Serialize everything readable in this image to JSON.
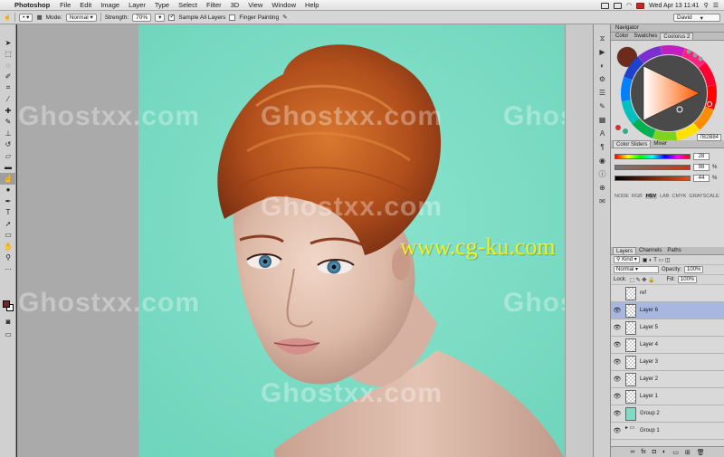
{
  "menubar": {
    "app_name": "Photoshop",
    "items": [
      "File",
      "Edit",
      "Image",
      "Layer",
      "Type",
      "Select",
      "Filter",
      "3D",
      "View",
      "Window",
      "Help"
    ],
    "clock": "Wed Apr 13  11:41"
  },
  "options_bar": {
    "mode_label": "Mode:",
    "mode_value": "Normal",
    "strength_label": "Strength:",
    "strength_value": "70%",
    "sample_all_layers": "Sample All Layers",
    "finger_painting": "Finger Painting",
    "workspace": "David"
  },
  "colours_panel": {
    "tabs": [
      "Color",
      "Swatches",
      "Coolorus 2"
    ],
    "hex": "7B2B84",
    "foreground_color": "#6e2a1b"
  },
  "navigator_tab": "Navigator",
  "sliders_panel": {
    "tabs": [
      "Color Sliders",
      "Mixer"
    ],
    "rows": [
      {
        "value": "28",
        "unit": "",
        "color": "#f00"
      },
      {
        "value": "98",
        "unit": "%",
        "color": "#6e2a1b"
      },
      {
        "value": "44",
        "unit": "%",
        "color": "#6e2a1b"
      }
    ],
    "modes": [
      "NODE",
      "RGB",
      "HSV",
      "LAB",
      "CMYK",
      "GRAYSCALE"
    ],
    "selected_mode": "HSV"
  },
  "layers_panel": {
    "tabs": [
      "Layers",
      "Channels",
      "Paths"
    ],
    "kind": "Kind",
    "blend_mode": "Normal",
    "opacity_label": "Opacity:",
    "opacity": "100%",
    "lock_label": "Lock:",
    "fill_label": "Fill:",
    "fill": "100%",
    "layers": [
      {
        "name": "ref",
        "selected": false,
        "visible": false,
        "thumb": "checker"
      },
      {
        "name": "Layer 6",
        "selected": true,
        "visible": true,
        "thumb": "checker"
      },
      {
        "name": "Layer 5",
        "selected": false,
        "visible": true,
        "thumb": "checker"
      },
      {
        "name": "Layer 4",
        "selected": false,
        "visible": true,
        "thumb": "checker"
      },
      {
        "name": "Layer 3",
        "selected": false,
        "visible": true,
        "thumb": "checker"
      },
      {
        "name": "Layer 2",
        "selected": false,
        "visible": true,
        "thumb": "checker"
      },
      {
        "name": "Layer 1",
        "selected": false,
        "visible": true,
        "thumb": "checker"
      },
      {
        "name": "Group 2",
        "selected": false,
        "visible": true,
        "thumb": "art"
      },
      {
        "name": "Group 1",
        "selected": false,
        "visible": true,
        "thumb": "folder"
      }
    ]
  },
  "watermarks": {
    "ghost": "Ghostxx.com",
    "site": "www.cg-ku.com"
  }
}
